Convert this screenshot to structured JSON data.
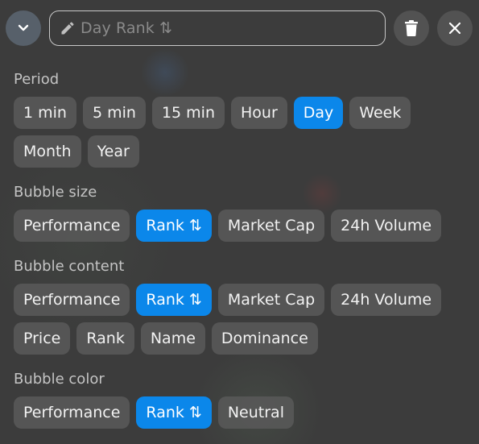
{
  "header": {
    "title": "Day Rank ⇅",
    "icons": {
      "collapse": "chevron-down-icon",
      "edit": "pencil-icon",
      "delete": "trash-icon",
      "close": "close-icon"
    }
  },
  "colors": {
    "accent": "#0b87ea",
    "chip_bg": "#5a5a5a",
    "background": "#3c3c3c",
    "label": "#c4c4c4"
  },
  "sections": {
    "period": {
      "label": "Period",
      "options": [
        "1 min",
        "5 min",
        "15 min",
        "Hour",
        "Day",
        "Week",
        "Month",
        "Year"
      ],
      "selected": "Day"
    },
    "bubble_size": {
      "label": "Bubble size",
      "options": [
        "Performance",
        "Rank ⇅",
        "Market Cap",
        "24h Volume"
      ],
      "selected": "Rank ⇅"
    },
    "bubble_content": {
      "label": "Bubble content",
      "options": [
        "Performance",
        "Rank ⇅",
        "Market Cap",
        "24h Volume",
        "Price",
        "Rank",
        "Name",
        "Dominance"
      ],
      "selected": "Rank ⇅"
    },
    "bubble_color": {
      "label": "Bubble color",
      "options": [
        "Performance",
        "Rank ⇅",
        "Neutral"
      ],
      "selected": "Rank ⇅"
    }
  }
}
